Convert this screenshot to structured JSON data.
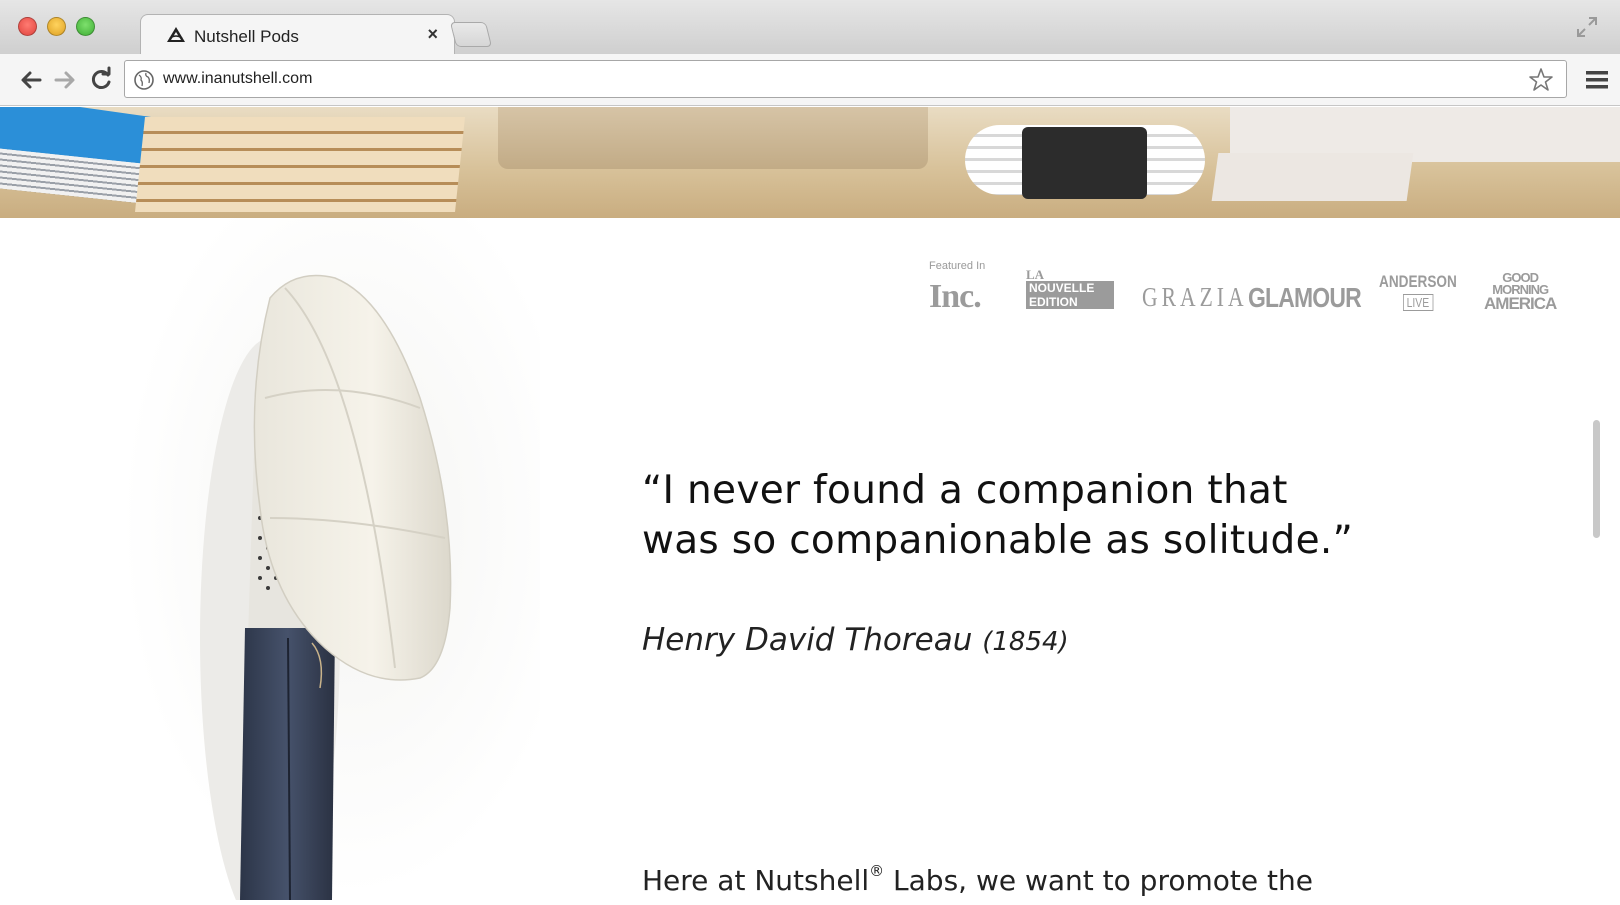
{
  "browser": {
    "tab": {
      "title": "Nutshell Pods",
      "close_label": "×"
    },
    "address_bar": {
      "url": "www.inanutshell.com"
    },
    "icons": [
      "back-icon",
      "forward-icon",
      "reload-icon",
      "globe-icon",
      "star-icon",
      "menu-icon",
      "fullscreen-icon"
    ]
  },
  "page": {
    "press": {
      "label": "Featured In",
      "logos": {
        "inc": "Inc.",
        "nouvelle_la": "LA",
        "nouvelle_line1": "NOUVELLE",
        "nouvelle_line2": "EDITION",
        "grazia": "GRAZIA",
        "glamour": "GLAMOUR",
        "anderson": "ANDERSON",
        "anderson_live": "LIVE",
        "gma_line1": "GOOD",
        "gma_line2": "MORNING",
        "gma_line3": "AMERICA"
      }
    },
    "quote": {
      "text_line1": "“I never found a companion that",
      "text_line2": "was so companionable as solitude.”",
      "author": "Henry David Thoreau",
      "year": "(1854)"
    },
    "intro": {
      "before": "Here at Nutshell",
      "mark": "®",
      "after": " Labs, we want to promote the"
    }
  },
  "colors": {
    "logo_gray": "#9b9b9b",
    "text_dark": "#111111"
  }
}
